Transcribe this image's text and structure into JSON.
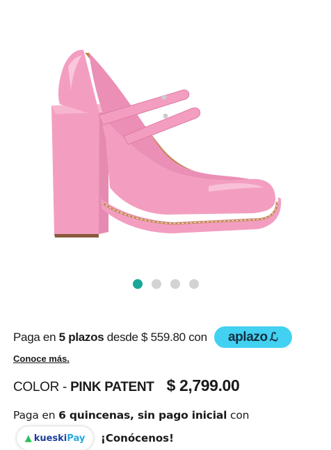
{
  "product": {
    "image_alt": "Pink patent Mary Jane platform heel",
    "carousel": {
      "total": 4,
      "active": 1
    },
    "colors": {
      "shoe": "#f39ec0",
      "shoe_dark": "#e07aa3",
      "lining": "#c48654",
      "accent": "#19a79b",
      "dot": "#d3d3d3"
    }
  },
  "installments": {
    "prefix": "Paga en ",
    "plazos": "5 plazos",
    "middle": " desde $ 559.80 con",
    "provider": "aplazo",
    "provider_color": "#43d1f2",
    "learn_more": "Conoce más."
  },
  "color": {
    "label": "COLOR - ",
    "value": "PINK PATENT",
    "price": "$ 2,799.00"
  },
  "quincena": {
    "prefix": "Paga en ",
    "bold": "6 quincenas, sin pago inicial",
    "suffix": " con"
  },
  "kueski": {
    "brand_part1": "kueski",
    "brand_part2": "Pay",
    "cta": "¡Conócenos!"
  }
}
